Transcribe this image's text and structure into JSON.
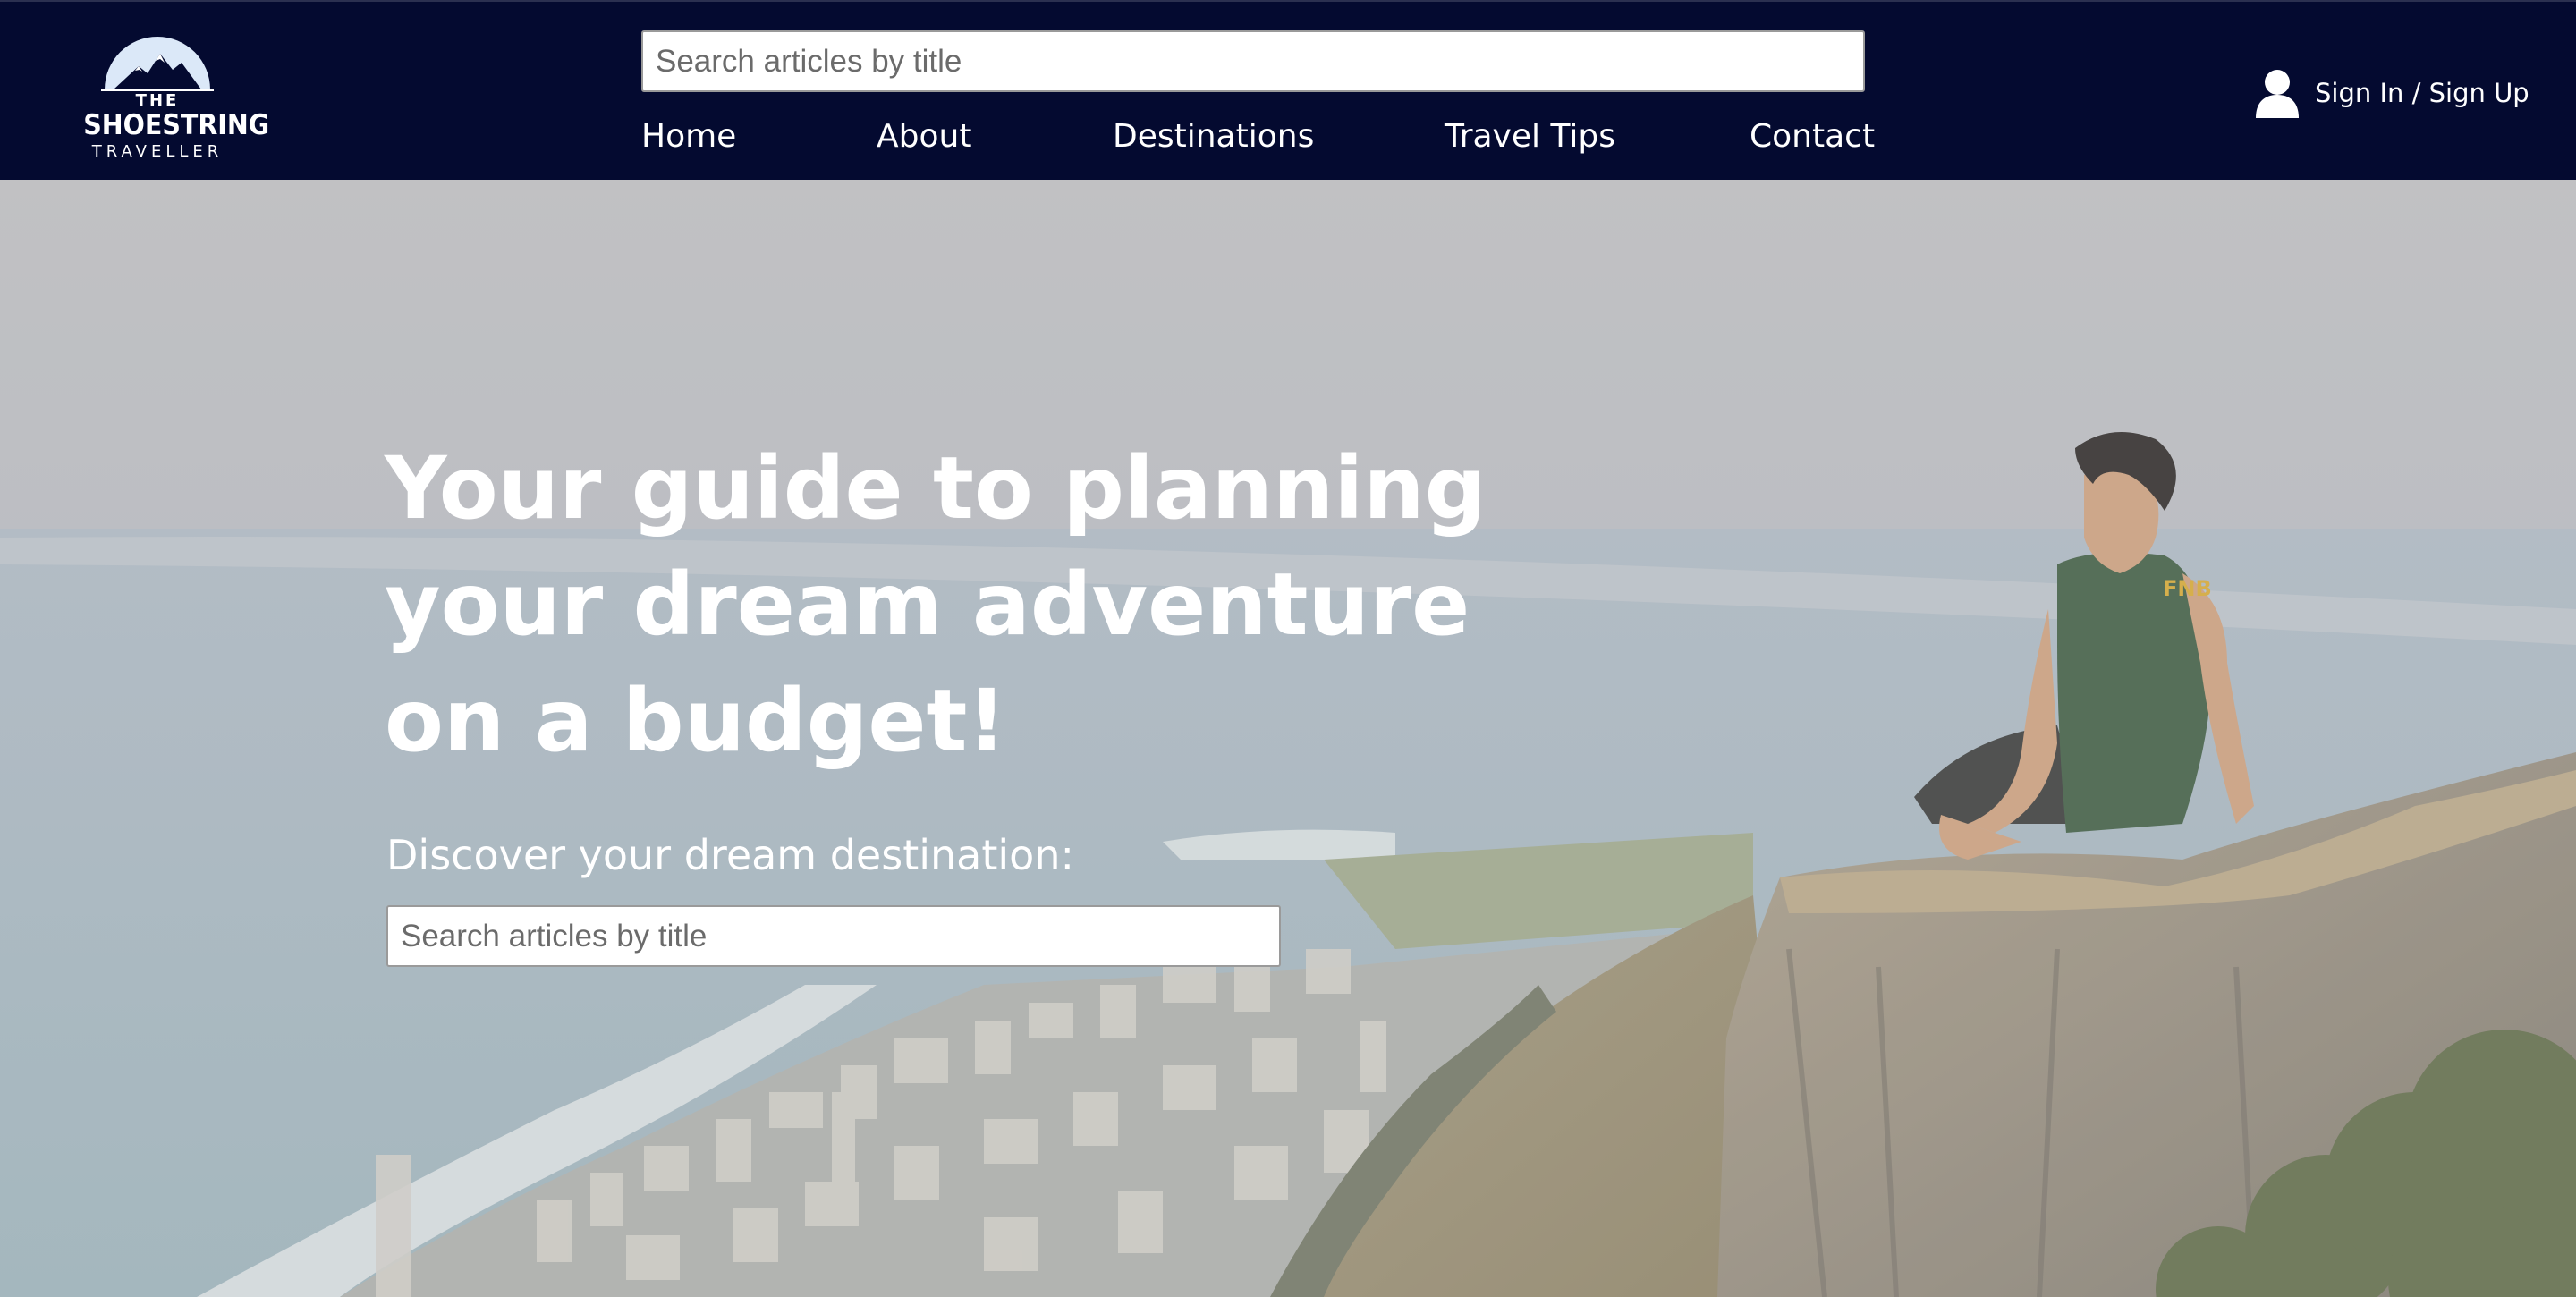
{
  "header": {
    "logo": {
      "top": "THE",
      "main": "SHOESTRING",
      "sub": "TRAVELLER"
    },
    "search": {
      "placeholder": "Search articles by title",
      "value": ""
    },
    "nav": [
      "Home",
      "About",
      "Destinations",
      "Travel Tips",
      "Contact"
    ],
    "signin": {
      "label": "Sign In / Sign Up",
      "icon": "user-icon"
    }
  },
  "hero": {
    "title_lines": [
      "Your guide to planning",
      "your dream adventure",
      "on a budget!"
    ],
    "subtitle": "Discover your dream destination:",
    "search": {
      "placeholder": "Search articles by title",
      "value": ""
    },
    "shirt_text": "FNB"
  },
  "colors": {
    "header_bg": "#040a30",
    "text": "#ffffff",
    "input_bg": "#ffffff",
    "input_border": "#9a9a9a"
  }
}
